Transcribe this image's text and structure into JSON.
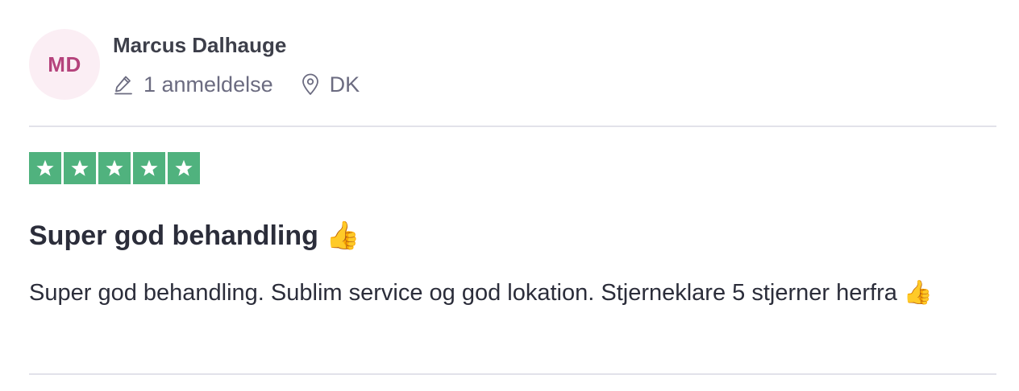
{
  "reviewer": {
    "initials": "MD",
    "name": "Marcus Dalhauge",
    "review_count_text": "1 anmeldelse",
    "country": "DK",
    "review_count_icon": "pencil-icon",
    "location_icon": "location-pin-icon"
  },
  "rating": {
    "stars": 5,
    "max": 5,
    "star_color": "#50b27e"
  },
  "review": {
    "title": "Super god behandling 👍",
    "body": "Super god behandling. Sublim service og god lokation. Stjerneklare 5 stjerner herfra 👍"
  },
  "colors": {
    "avatar_bg": "#fbeef4",
    "avatar_text": "#b5437c",
    "divider": "#e2e2ea"
  }
}
